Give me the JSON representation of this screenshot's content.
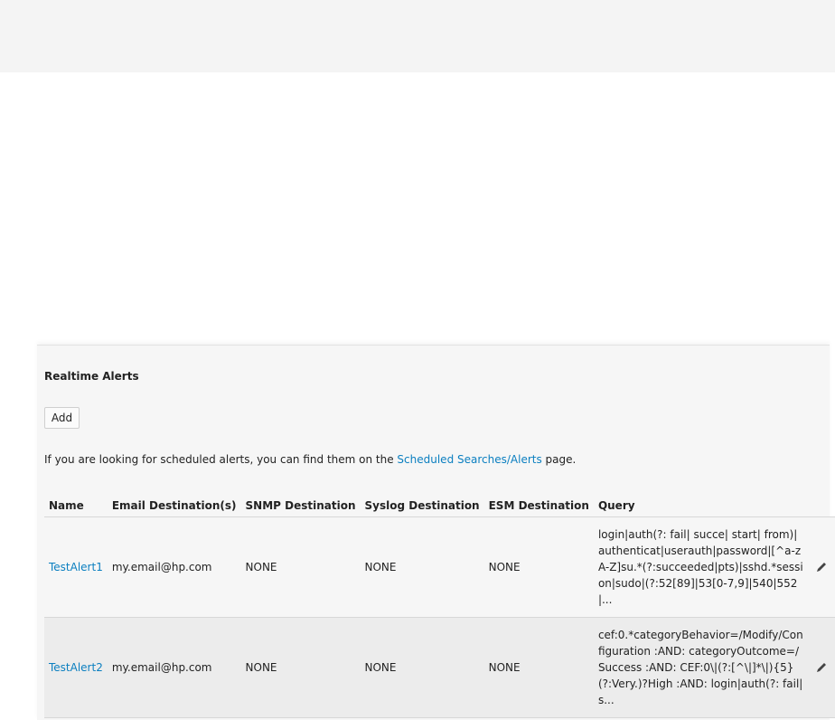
{
  "section_title": "Realtime Alerts",
  "add_button": "Add",
  "info": {
    "before": "If you are looking for scheduled alerts, you can find them on the ",
    "link": "Scheduled Searches/Alerts",
    "after": " page."
  },
  "columns": [
    "Name",
    "Email Destination(s)",
    "SNMP Destination",
    "Syslog Destination",
    "ESM Destination",
    "Query"
  ],
  "rows": [
    {
      "name": "TestAlert1",
      "email": "my.email@hp.com",
      "snmp": "NONE",
      "syslog": "NONE",
      "esm": "NONE",
      "query": "login|auth(?: fail| succe| start| from)|authenticat|userauth|password|[^a-zA-Z]su.*(?:succeeded|pts)|sshd.*session|sudo|(?:52[89]|53[0-7,9]|540|552|...",
      "status_icon": "disabled-icon"
    },
    {
      "name": "TestAlert2",
      "email": "my.email@hp.com",
      "snmp": "NONE",
      "syslog": "NONE",
      "esm": "NONE",
      "query": "cef:0.*categoryBehavior=/Modify/Configuration :AND: categoryOutcome=/Success :AND: CEF:0\\|(?:[^\\|]*\\|){5}(?:Very.)?High :AND: login|auth(?: fail| s...",
      "status_icon": "enabled-check-icon"
    }
  ],
  "colors": {
    "link": "#0b7fc0",
    "disabled": "#e02020",
    "enabled": "#3aa635"
  }
}
